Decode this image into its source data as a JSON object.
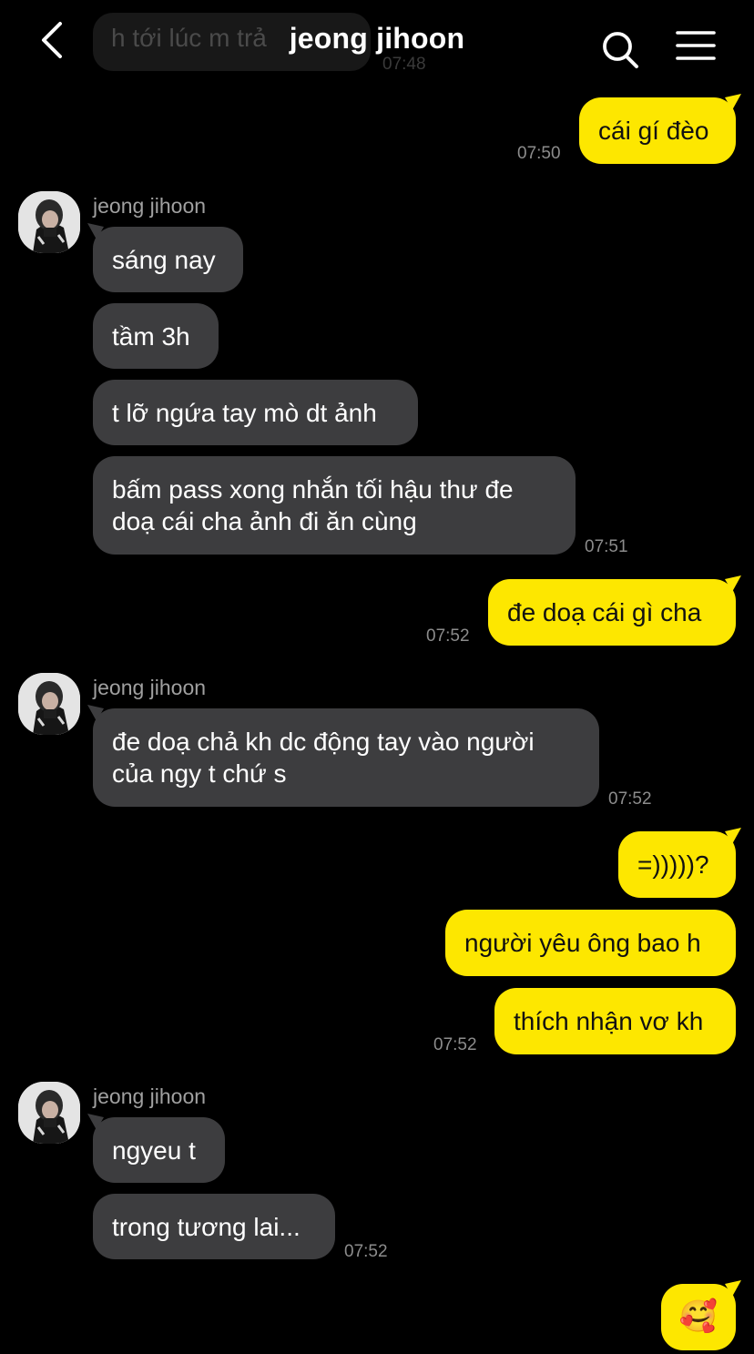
{
  "header": {
    "title": "jeong jihoon",
    "icons": [
      "back-arrow-icon",
      "search-icon",
      "menu-icon"
    ]
  },
  "ghost": {
    "text": "h tới lúc m trả",
    "time": "07:48"
  },
  "colors": {
    "background": "#000000",
    "incoming_bubble": "#3d3d3f",
    "outgoing_bubble": "#fde700"
  },
  "messages": {
    "m1": {
      "text": "cái gí đèo",
      "time": "07:50"
    },
    "sender1": "jeong jihoon",
    "m2": {
      "text": "sáng nay"
    },
    "m3": {
      "text": "tầm 3h"
    },
    "m4": {
      "text": "t lỡ ngứa tay mò dt ảnh"
    },
    "m5": {
      "line1": "bấm pass xong nhắn tối hậu thư đe",
      "line2": "doạ cái cha ảnh đi ăn cùng",
      "time": "07:51"
    },
    "m6": {
      "text": "đe doạ cái gì cha",
      "time": "07:52"
    },
    "sender2": "jeong jihoon",
    "m7": {
      "line1": "đe doạ chả kh dc động tay vào người",
      "line2": "của ngy t chứ s",
      "time": "07:52"
    },
    "m8": {
      "text": "=)))))?"
    },
    "m9": {
      "text": "người yêu ông bao h"
    },
    "m10": {
      "text": "thích nhận vơ kh",
      "time": "07:52"
    },
    "sender3": "jeong jihoon",
    "m11": {
      "text": "ngyeu t"
    },
    "m12": {
      "text": "trong tương lai...",
      "time": "07:52"
    },
    "m13": {
      "emoji": "🥰",
      "icon": "smiling-face-with-hearts-icon"
    }
  }
}
